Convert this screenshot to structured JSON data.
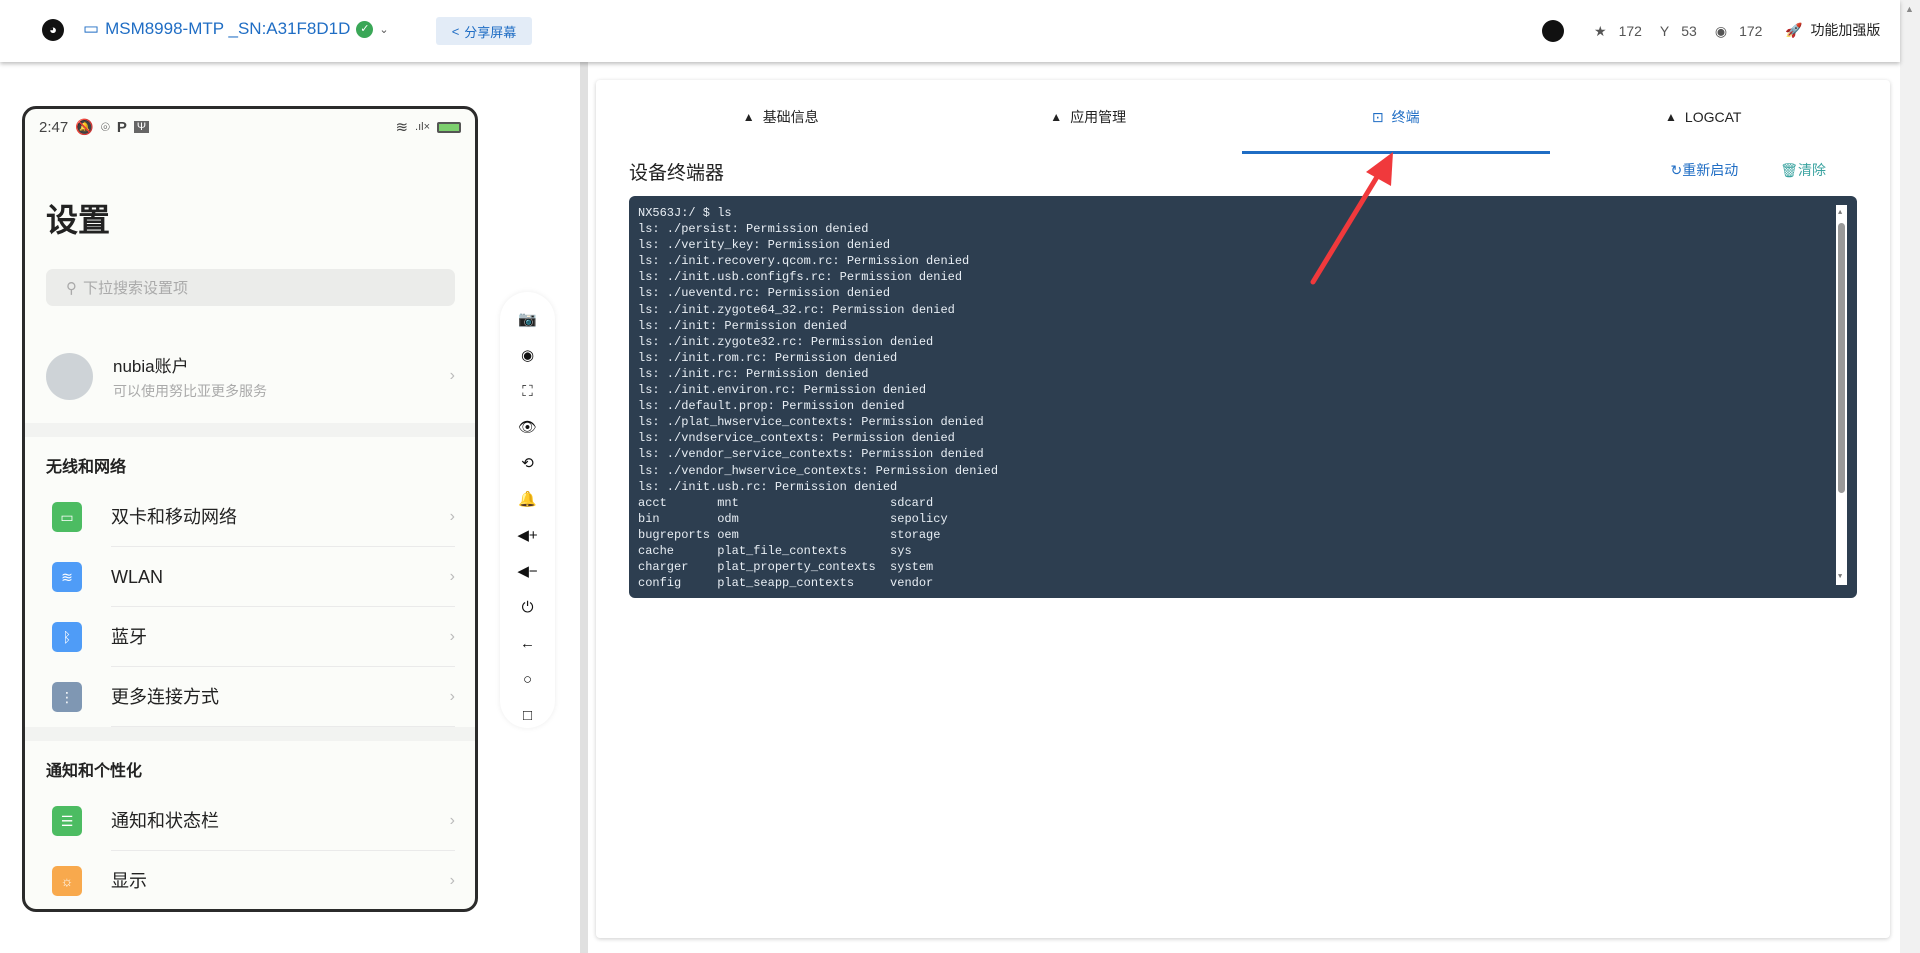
{
  "header": {
    "device": "MSM8998-MTP _SN:A31F8D1D",
    "share": "分享屏幕",
    "stars": "172",
    "forks": "53",
    "watchers": "172",
    "boost": "功能加强版"
  },
  "phone": {
    "time": "2:47",
    "title": "设置",
    "search_placeholder": "下拉搜索设置项",
    "account_name": "nubia账户",
    "account_sub": "可以使用努比亚更多服务",
    "section1": "无线和网络",
    "items1": [
      "双卡和移动网络",
      "WLAN",
      "蓝牙",
      "更多连接方式"
    ],
    "section2": "通知和个性化",
    "items2": [
      "通知和状态栏",
      "显示"
    ]
  },
  "tabs": [
    "基础信息",
    "应用管理",
    "终端",
    "LOGCAT"
  ],
  "terminal": {
    "title": "设备终端器",
    "restart": "重新启动",
    "clear": "清除",
    "output": "NX563J:/ $ ls\nls: ./persist: Permission denied\nls: ./verity_key: Permission denied\nls: ./init.recovery.qcom.rc: Permission denied\nls: ./init.usb.configfs.rc: Permission denied\nls: ./ueventd.rc: Permission denied\nls: ./init.zygote64_32.rc: Permission denied\nls: ./init: Permission denied\nls: ./init.zygote32.rc: Permission denied\nls: ./init.rom.rc: Permission denied\nls: ./init.rc: Permission denied\nls: ./init.environ.rc: Permission denied\nls: ./default.prop: Permission denied\nls: ./plat_hwservice_contexts: Permission denied\nls: ./vndservice_contexts: Permission denied\nls: ./vendor_service_contexts: Permission denied\nls: ./vendor_hwservice_contexts: Permission denied\nls: ./init.usb.rc: Permission denied\nacct       mnt                     sdcard\nbin        odm                     sepolicy\nbugreports oem                     storage\ncache      plat_file_contexts      sys\ncharger    plat_property_contexts  system\nconfig     plat_seapp_contexts     vendor"
  }
}
